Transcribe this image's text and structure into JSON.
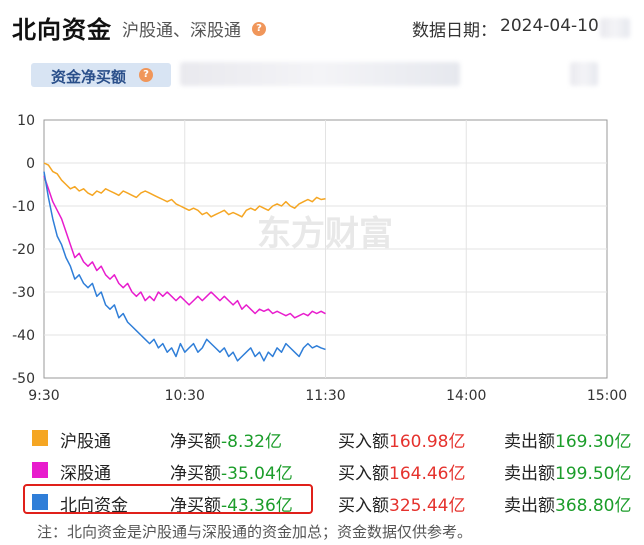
{
  "header": {
    "title": "北向资金",
    "subtitle": "沪股通、深股通",
    "help_glyph": "?",
    "date_label": "数据日期：",
    "date_value": "2024-04-10"
  },
  "tab": {
    "label": "资金净买额",
    "help_glyph": "?"
  },
  "chart_data": {
    "type": "line",
    "x_ticks": [
      "9:30",
      "10:30",
      "11:30",
      "14:00",
      "15:00"
    ],
    "y_ticks": [
      10,
      0,
      -10,
      -20,
      -30,
      -40,
      -50
    ],
    "ylim": [
      -50,
      10
    ],
    "x_range": [
      "9:30",
      "15:00"
    ],
    "grid": true,
    "watermark": "东方财富",
    "series": [
      {
        "name": "沪股通",
        "color": "#f5a623",
        "values": [
          0,
          -0.5,
          -2,
          -2.5,
          -4,
          -5,
          -6,
          -5.5,
          -6.5,
          -6,
          -7,
          -7.5,
          -6.5,
          -7,
          -6,
          -6.5,
          -7,
          -7.5,
          -6.5,
          -7,
          -7.5,
          -8,
          -7,
          -6.5,
          -7,
          -7.5,
          -8,
          -8.5,
          -9,
          -8.5,
          -9.5,
          -10,
          -10.5,
          -11,
          -10.5,
          -11,
          -12,
          -11.5,
          -12.5,
          -12,
          -11.5,
          -11,
          -12,
          -11.5,
          -12,
          -12.5,
          -11,
          -10.5,
          -11,
          -10,
          -10.5,
          -11,
          -10,
          -9.5,
          -10,
          -9,
          -10,
          -10.5,
          -9.5,
          -9,
          -8.5,
          -9,
          -8,
          -8.5,
          -8.3
        ]
      },
      {
        "name": "深股通",
        "color": "#e81ccd",
        "values": [
          -3,
          -6,
          -9,
          -11,
          -13,
          -16,
          -19,
          -22,
          -21,
          -23,
          -24,
          -23,
          -25,
          -24,
          -26,
          -27,
          -26,
          -28,
          -29,
          -28,
          -30,
          -31,
          -30,
          -32,
          -31,
          -32,
          -30,
          -31,
          -30,
          -31,
          -32,
          -31,
          -32,
          -33,
          -32,
          -31,
          -32,
          -31,
          -30,
          -31,
          -32,
          -31,
          -32,
          -33,
          -32,
          -34,
          -33,
          -34,
          -35,
          -34,
          -34.5,
          -34,
          -35,
          -34.5,
          -35,
          -35.5,
          -35,
          -36,
          -35.5,
          -35,
          -35.5,
          -34.5,
          -35,
          -34.5,
          -35.04
        ]
      },
      {
        "name": "北向资金",
        "color": "#2f7ed8",
        "values": [
          -2,
          -8,
          -13,
          -17,
          -19,
          -22,
          -24,
          -27,
          -26,
          -28,
          -29,
          -28,
          -31,
          -30,
          -33,
          -34,
          -33,
          -36,
          -35,
          -37,
          -38,
          -39,
          -40,
          -41,
          -42,
          -41,
          -43,
          -42,
          -44,
          -43,
          -45,
          -42,
          -44,
          -43,
          -42,
          -44,
          -43,
          -41,
          -42,
          -43,
          -44,
          -43,
          -45,
          -44,
          -46,
          -45,
          -44,
          -43,
          -45,
          -44,
          -46,
          -44,
          -45,
          -43,
          -44,
          -42,
          -43,
          -44,
          -45,
          -43,
          -42,
          -43,
          -42.5,
          -43,
          -43.36
        ]
      }
    ]
  },
  "legend": [
    {
      "name": "沪股通",
      "color": "#f5a623",
      "net_label": "净买额",
      "net_value": "-8.32亿",
      "buy_label": "买入额",
      "buy_value": "160.98亿",
      "sell_label": "卖出额",
      "sell_value": "169.30亿"
    },
    {
      "name": "深股通",
      "color": "#e81ccd",
      "net_label": "净买额",
      "net_value": "-35.04亿",
      "buy_label": "买入额",
      "buy_value": "164.46亿",
      "sell_label": "卖出额",
      "sell_value": "199.50亿"
    },
    {
      "name": "北向资金",
      "color": "#2f7ed8",
      "net_label": "净买额",
      "net_value": "-43.36亿",
      "buy_label": "买入额",
      "buy_value": "325.44亿",
      "sell_label": "卖出额",
      "sell_value": "368.80亿"
    }
  ],
  "note": "注：北向资金是沪股通与深股通的资金加总；资金数据仅供参考。"
}
